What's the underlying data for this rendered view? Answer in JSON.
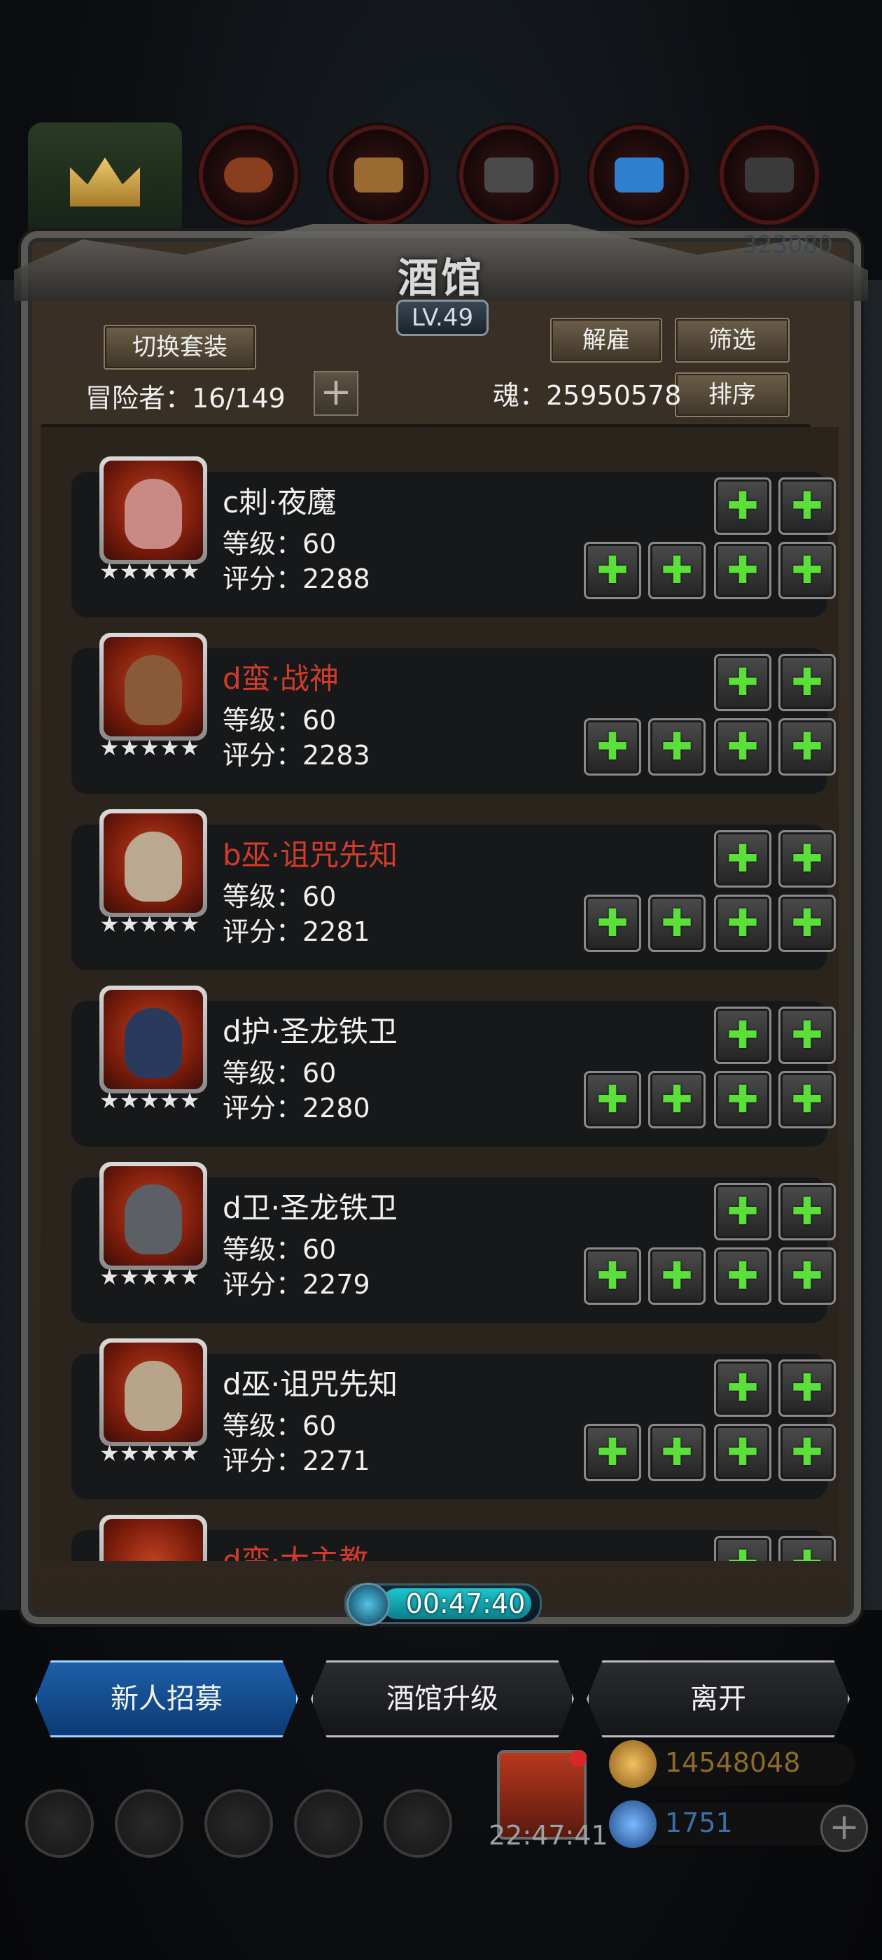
{
  "header": {
    "title": "酒馆",
    "level": "LV.49",
    "switch_outfit": "切换套装",
    "dismiss": "解雇",
    "filter": "筛选",
    "sort": "排序",
    "adventurers_label": "冒险者：16/149",
    "souls_label": "魂：25950578",
    "faint_number": "323080"
  },
  "heroes": [
    {
      "name": "c刺·夜魔",
      "level": "等级：60",
      "score": "评分：2288",
      "red": false,
      "face": "#c98a86"
    },
    {
      "name": "d蛮·战神",
      "level": "等级：60",
      "score": "评分：2283",
      "red": true,
      "face": "#8a5a38"
    },
    {
      "name": "b巫·诅咒先知",
      "level": "等级：60",
      "score": "评分：2281",
      "red": true,
      "face": "#bba890"
    },
    {
      "name": "d护·圣龙铁卫",
      "level": "等级：60",
      "score": "评分：2280",
      "red": false,
      "face": "#2a3a5c"
    },
    {
      "name": "d卫·圣龙铁卫",
      "level": "等级：60",
      "score": "评分：2279",
      "red": false,
      "face": "#5c6064"
    },
    {
      "name": "d巫·诅咒先知",
      "level": "等级：60",
      "score": "评分：2271",
      "red": false,
      "face": "#b8a48a"
    }
  ],
  "partial_hero_name": "d蛮·大主教",
  "stars": "★★★★★",
  "slot_plus": "✚",
  "timer": "00:47:40",
  "buttons": {
    "recruit": "新人招募",
    "upgrade": "酒馆升级",
    "leave": "离开"
  },
  "clock": "22:47:41",
  "resources": {
    "gold": "14548048",
    "gems": "1751"
  },
  "colors": {
    "hero_red_name": "#d23b2b",
    "slot_plus_green": "#5be03a",
    "gold_text": "#8c6a2a",
    "gem_text": "#3a6fa8"
  }
}
